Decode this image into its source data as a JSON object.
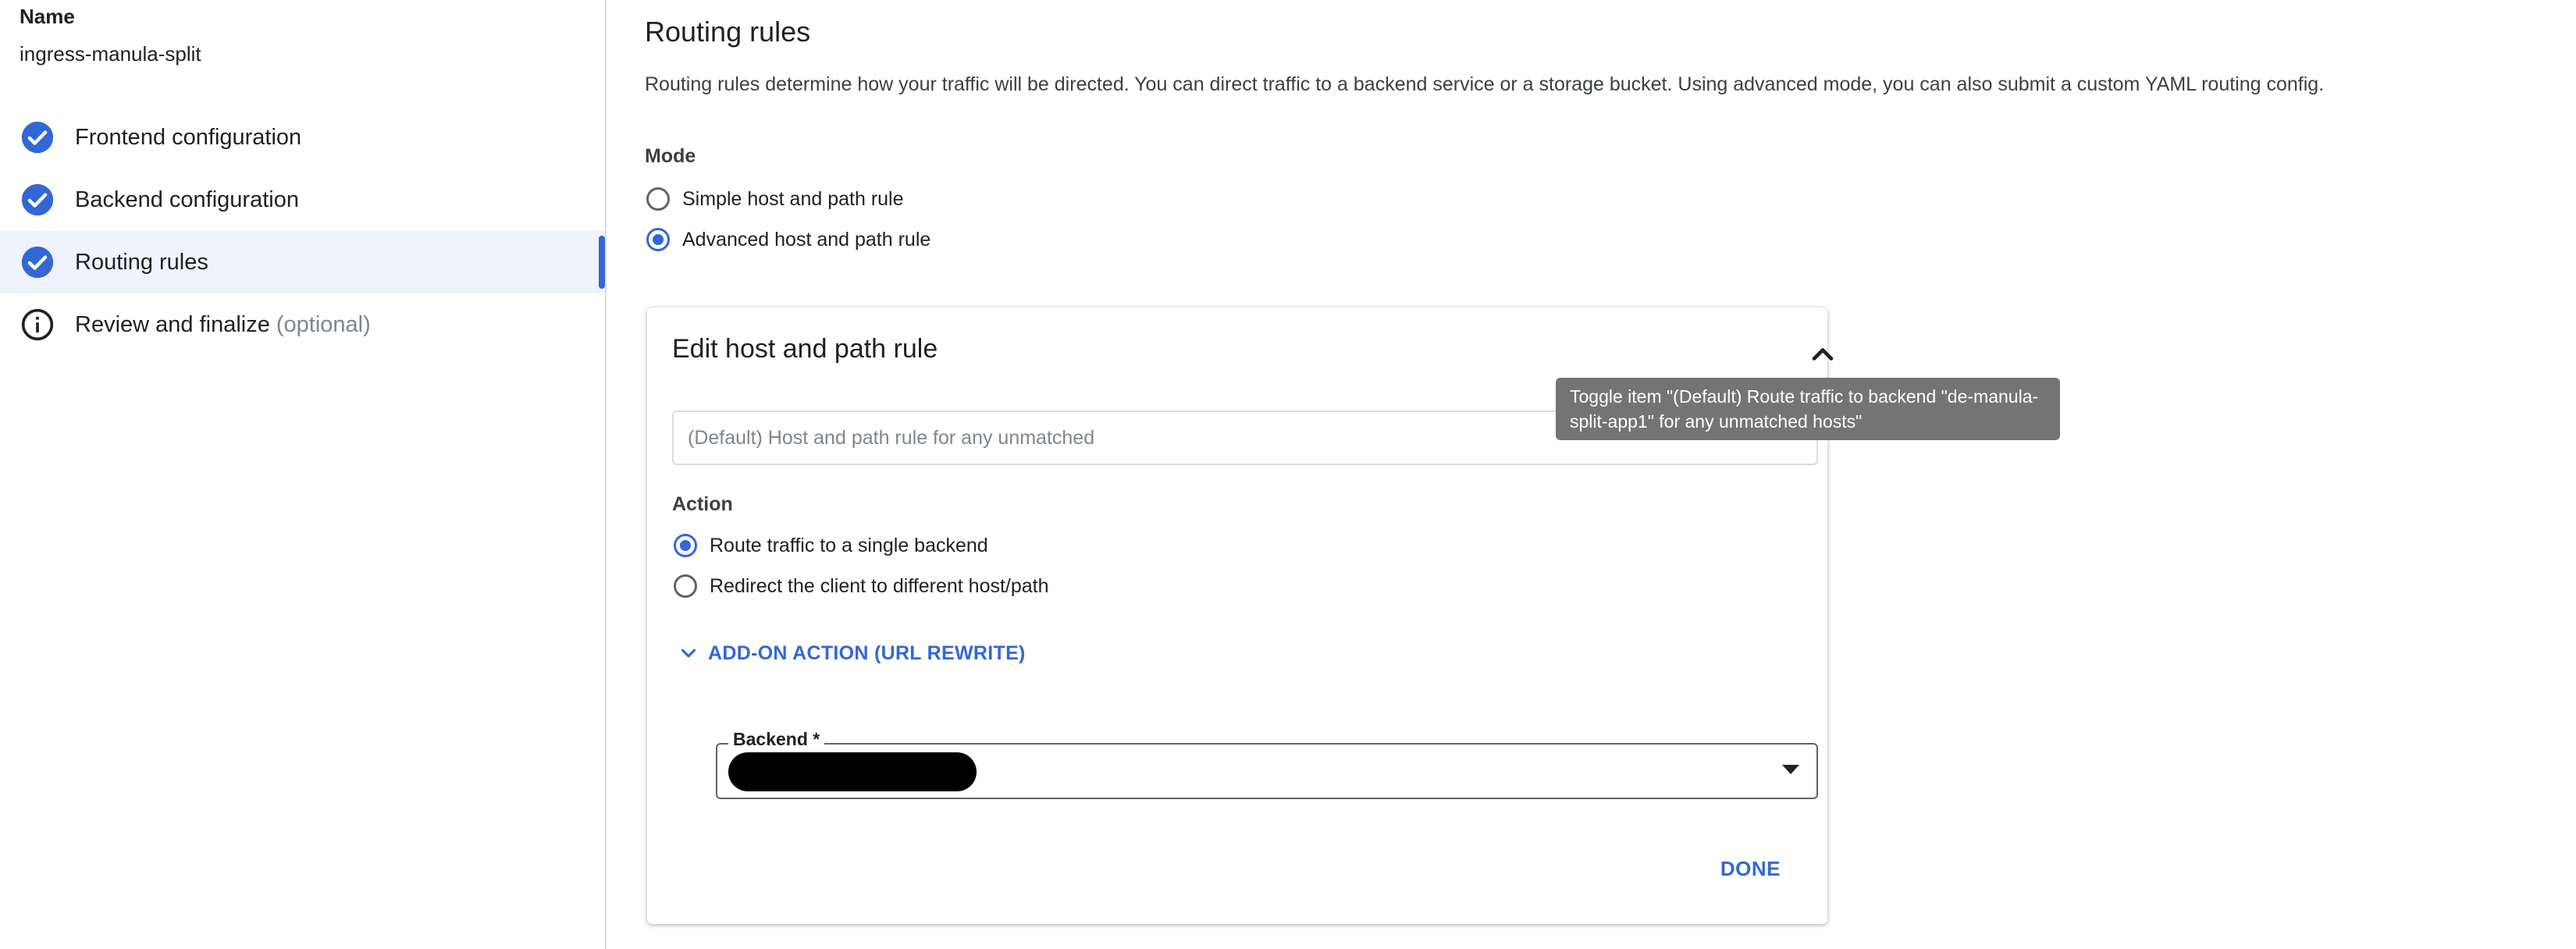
{
  "sidebar": {
    "name_label": "Name",
    "name_value": "ingress-manula-split",
    "steps": [
      {
        "label": "Frontend configuration",
        "icon": "check-circle-icon",
        "optional": ""
      },
      {
        "label": "Backend configuration",
        "icon": "check-circle-icon",
        "optional": ""
      },
      {
        "label": "Routing rules",
        "icon": "check-circle-icon",
        "optional": "",
        "active": true
      },
      {
        "label": "Review and finalize",
        "icon": "info-icon",
        "optional": "(optional)"
      }
    ]
  },
  "main": {
    "title": "Routing rules",
    "description": "Routing rules determine how your traffic will be directed. You can direct traffic to a backend service or a storage bucket. Using advanced mode, you can also submit a custom YAML routing config.",
    "mode_label": "Mode",
    "mode_options": [
      {
        "label": "Simple host and path rule",
        "checked": false
      },
      {
        "label": "Advanced host and path rule",
        "checked": true
      }
    ]
  },
  "card": {
    "title": "Edit host and path rule",
    "rule_placeholder": "(Default) Host and path rule for any unmatched",
    "action_label": "Action",
    "action_options": [
      {
        "label": "Route traffic to a single backend",
        "checked": true
      },
      {
        "label": "Redirect the client to different host/path",
        "checked": false
      }
    ],
    "addon_label": "ADD-ON ACTION (URL REWRITE)",
    "backend_label": "Backend *",
    "done_label": "DONE"
  },
  "tooltip": {
    "text": "Toggle item \"(Default) Route traffic to backend \"de-manula-split-app1\" for any unmatched hosts\""
  },
  "colors": {
    "accent": "#3367d6",
    "active_step_bg": "#eef3fd",
    "tooltip_bg": "#747474"
  }
}
